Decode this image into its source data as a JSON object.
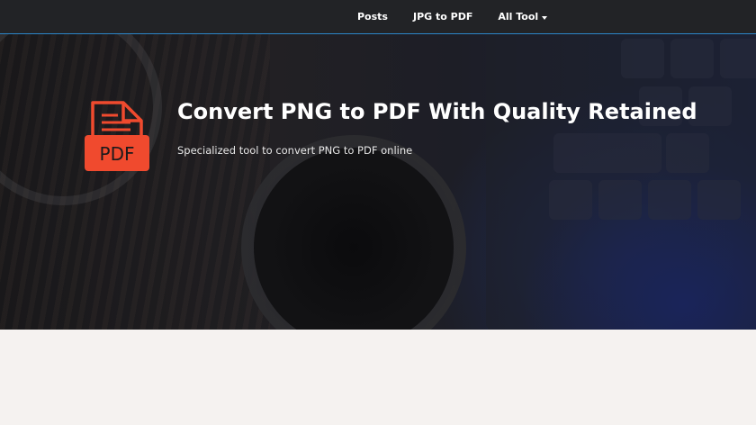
{
  "nav": {
    "items": [
      {
        "label": "Posts"
      },
      {
        "label": "JPG to PDF"
      },
      {
        "label": "All Tool"
      }
    ]
  },
  "hero": {
    "icon_label": "PDF",
    "title": "Convert PNG to PDF With Quality Retained",
    "subtitle": "Specialized tool to convert PNG to PDF online"
  },
  "colors": {
    "navbar_bg": "#222326",
    "accent_line": "#2c86c9",
    "pdf_icon": "#f04a2e",
    "page_bg": "#f5f2f0"
  },
  "icons": [
    "pdf-file-icon",
    "caret-down-icon"
  ]
}
